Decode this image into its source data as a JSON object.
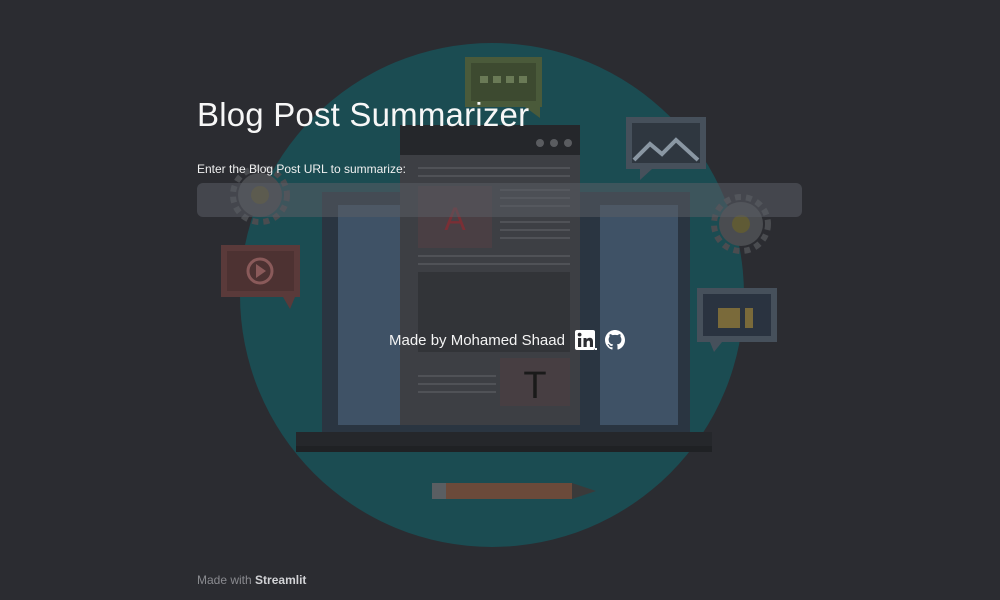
{
  "app": {
    "title": "Blog Post Summarizer"
  },
  "form": {
    "url_label": "Enter the Blog Post URL to summarize:",
    "url_value": "",
    "url_placeholder": ""
  },
  "credits": {
    "text": "Made by Mohamed Shaad",
    "linkedin_icon": "linkedin-icon",
    "github_icon": "github-icon"
  },
  "background": {
    "icons": [
      "chat-bubble-icon",
      "image-frame-icon",
      "gear-icon",
      "gear-icon",
      "play-video-icon",
      "thumbs-up-icon",
      "laptop-icon",
      "pencil-icon"
    ],
    "letters": [
      "A",
      "T"
    ],
    "colors": {
      "page": "#2b2c31",
      "circle": "#1b4c52"
    }
  },
  "footer": {
    "prefix": "Made with",
    "brand": "Streamlit"
  }
}
